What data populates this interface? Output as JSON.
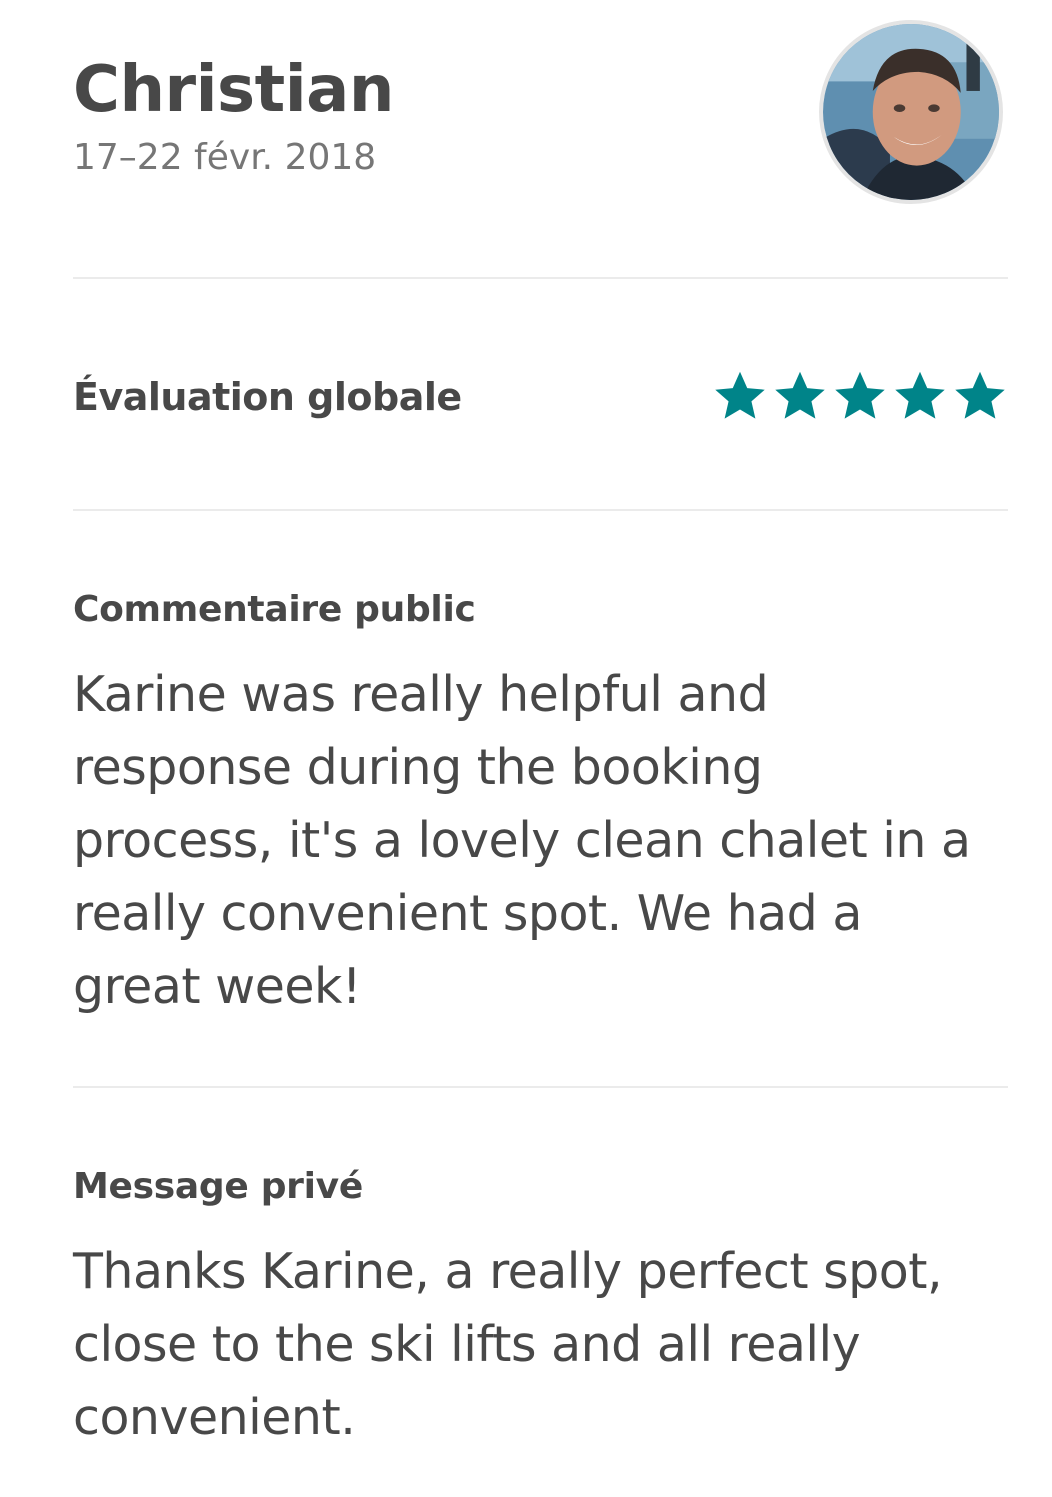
{
  "review": {
    "author": "Christian",
    "dates": "17–22 févr. 2018",
    "avatar_icon": "user-avatar-photo"
  },
  "rating": {
    "label": "Évaluation globale",
    "stars": 5,
    "max_stars": 5,
    "star_color": "#008489",
    "star_icon": "star-icon"
  },
  "public_comment": {
    "title": "Commentaire public",
    "text": "Karine was really helpful and response during the booking process, it's a lovely clean chalet in a really convenient spot. We had a great week!"
  },
  "private_message": {
    "title": "Message privé",
    "text": "Thanks Karine, a really perfect spot, close to the ski lifts and all really convenient."
  }
}
